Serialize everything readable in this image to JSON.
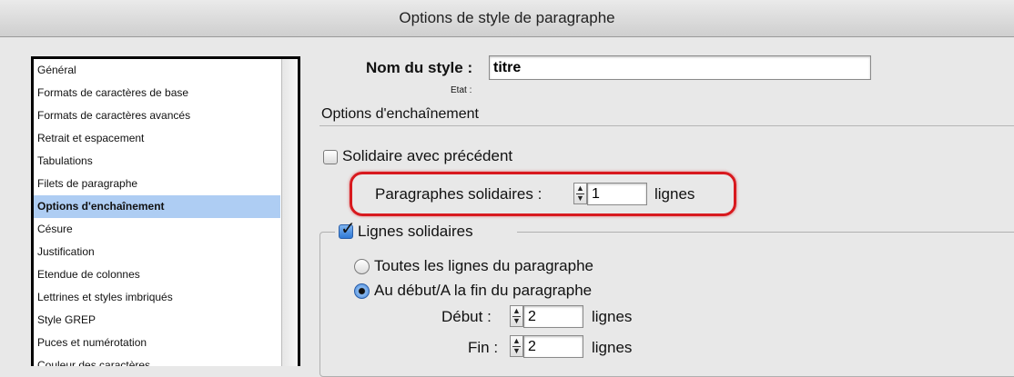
{
  "window": {
    "title": "Options de style de paragraphe"
  },
  "sidebar": {
    "items": [
      {
        "label": "Général"
      },
      {
        "label": "Formats de caractères de base"
      },
      {
        "label": "Formats de caractères avancés"
      },
      {
        "label": "Retrait et espacement"
      },
      {
        "label": "Tabulations"
      },
      {
        "label": "Filets de paragraphe"
      },
      {
        "label": "Options d'enchaînement",
        "selected": true
      },
      {
        "label": "Césure"
      },
      {
        "label": "Justification"
      },
      {
        "label": "Etendue de colonnes"
      },
      {
        "label": "Lettrines et styles imbriqués"
      },
      {
        "label": "Style GREP"
      },
      {
        "label": "Puces et numérotation"
      },
      {
        "label": "Couleur des caractères"
      }
    ]
  },
  "style": {
    "name_label": "Nom du style :",
    "name_value": "titre",
    "state_label": "Etat :"
  },
  "section": {
    "title": "Options d'enchaînement"
  },
  "keep_with_previous": {
    "label": "Solidaire avec précédent",
    "checked": false
  },
  "keep_with_next": {
    "label": "Paragraphes solidaires :",
    "value": "1",
    "unit": "lignes"
  },
  "keep_lines": {
    "label": "Lignes solidaires",
    "checked": true,
    "all_lines": {
      "label": "Toutes les lignes du paragraphe",
      "selected": false
    },
    "start_end": {
      "label": "Au début/A la fin du paragraphe",
      "selected": true
    },
    "start": {
      "label": "Début :",
      "value": "2",
      "unit": "lignes"
    },
    "end": {
      "label": "Fin :",
      "value": "2",
      "unit": "lignes"
    }
  },
  "colors": {
    "highlight": "#d8191e",
    "selection": "#aecdf3",
    "checkbox_checked": "#2f79d6"
  }
}
